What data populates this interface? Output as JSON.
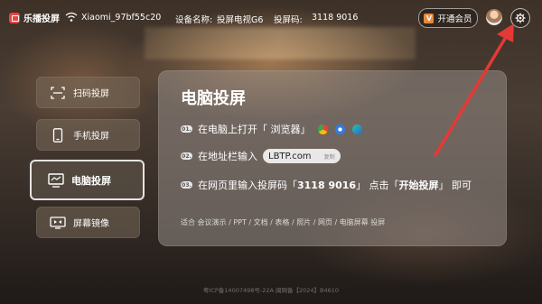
{
  "app": {
    "name": "乐播投屏"
  },
  "status_bar": {
    "wifi_name": "Xiaomi_97bf55c20",
    "device_label": "设备名称:",
    "device_name": "投屏电视G6",
    "code_label": "投屏码:",
    "code": "3118 9016"
  },
  "header": {
    "vip_label": "开通会员",
    "vip_badge": "V"
  },
  "sidebar": {
    "items": [
      {
        "label": "扫码投屏",
        "icon": "scan-icon"
      },
      {
        "label": "手机投屏",
        "icon": "phone-icon"
      },
      {
        "label": "电脑投屏",
        "icon": "monitor-icon",
        "active": true
      },
      {
        "label": "屏幕镜像",
        "icon": "mirror-icon"
      }
    ]
  },
  "panel": {
    "title": "电脑投屏",
    "steps": [
      {
        "num": "01.",
        "text": "在电脑上打开「 浏览器」"
      },
      {
        "num": "02.",
        "text": "在地址栏输入",
        "url": "LBTP.com",
        "copy": "复制"
      },
      {
        "num": "03.",
        "text_before": "在网页里输入投屏码「",
        "code": "3118 9016",
        "text_mid": "」 点击「",
        "action": "开始投屏",
        "text_after": "」 即可"
      }
    ],
    "footer": "适合 会议演示 / PPT / 文档 / 表格 / 照片 / 网页 / 电脑屏幕 投屏"
  },
  "icp_text": "粤ICP备14007498号-22A 闽网备【2024】B4610",
  "colors": {
    "accent": "#e8893a",
    "arrow": "#e53935",
    "logo": "#e64545"
  }
}
